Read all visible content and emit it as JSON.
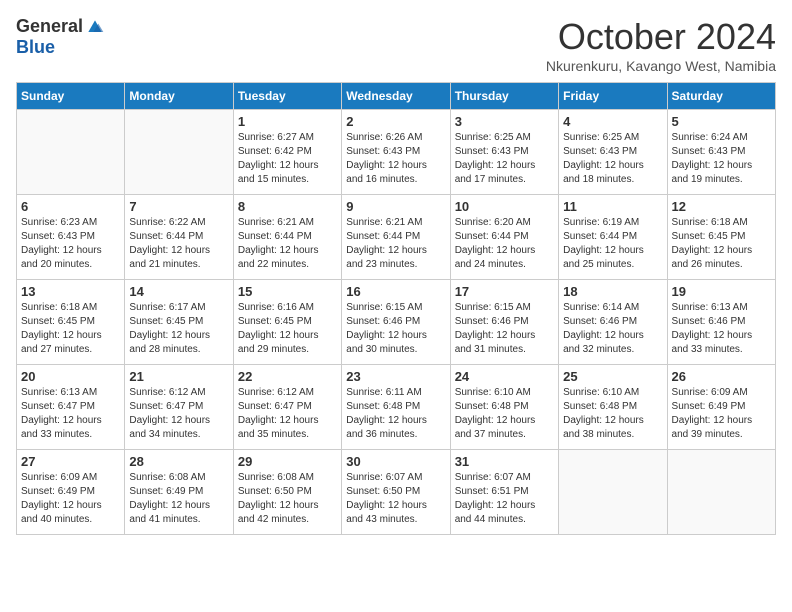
{
  "logo": {
    "general": "General",
    "blue": "Blue"
  },
  "header": {
    "month": "October 2024",
    "location": "Nkurenkuru, Kavango West, Namibia"
  },
  "weekdays": [
    "Sunday",
    "Monday",
    "Tuesday",
    "Wednesday",
    "Thursday",
    "Friday",
    "Saturday"
  ],
  "weeks": [
    [
      {
        "day": null
      },
      {
        "day": null
      },
      {
        "day": "1",
        "sunrise": "Sunrise: 6:27 AM",
        "sunset": "Sunset: 6:42 PM",
        "daylight": "Daylight: 12 hours and 15 minutes."
      },
      {
        "day": "2",
        "sunrise": "Sunrise: 6:26 AM",
        "sunset": "Sunset: 6:43 PM",
        "daylight": "Daylight: 12 hours and 16 minutes."
      },
      {
        "day": "3",
        "sunrise": "Sunrise: 6:25 AM",
        "sunset": "Sunset: 6:43 PM",
        "daylight": "Daylight: 12 hours and 17 minutes."
      },
      {
        "day": "4",
        "sunrise": "Sunrise: 6:25 AM",
        "sunset": "Sunset: 6:43 PM",
        "daylight": "Daylight: 12 hours and 18 minutes."
      },
      {
        "day": "5",
        "sunrise": "Sunrise: 6:24 AM",
        "sunset": "Sunset: 6:43 PM",
        "daylight": "Daylight: 12 hours and 19 minutes."
      }
    ],
    [
      {
        "day": "6",
        "sunrise": "Sunrise: 6:23 AM",
        "sunset": "Sunset: 6:43 PM",
        "daylight": "Daylight: 12 hours and 20 minutes."
      },
      {
        "day": "7",
        "sunrise": "Sunrise: 6:22 AM",
        "sunset": "Sunset: 6:44 PM",
        "daylight": "Daylight: 12 hours and 21 minutes."
      },
      {
        "day": "8",
        "sunrise": "Sunrise: 6:21 AM",
        "sunset": "Sunset: 6:44 PM",
        "daylight": "Daylight: 12 hours and 22 minutes."
      },
      {
        "day": "9",
        "sunrise": "Sunrise: 6:21 AM",
        "sunset": "Sunset: 6:44 PM",
        "daylight": "Daylight: 12 hours and 23 minutes."
      },
      {
        "day": "10",
        "sunrise": "Sunrise: 6:20 AM",
        "sunset": "Sunset: 6:44 PM",
        "daylight": "Daylight: 12 hours and 24 minutes."
      },
      {
        "day": "11",
        "sunrise": "Sunrise: 6:19 AM",
        "sunset": "Sunset: 6:44 PM",
        "daylight": "Daylight: 12 hours and 25 minutes."
      },
      {
        "day": "12",
        "sunrise": "Sunrise: 6:18 AM",
        "sunset": "Sunset: 6:45 PM",
        "daylight": "Daylight: 12 hours and 26 minutes."
      }
    ],
    [
      {
        "day": "13",
        "sunrise": "Sunrise: 6:18 AM",
        "sunset": "Sunset: 6:45 PM",
        "daylight": "Daylight: 12 hours and 27 minutes."
      },
      {
        "day": "14",
        "sunrise": "Sunrise: 6:17 AM",
        "sunset": "Sunset: 6:45 PM",
        "daylight": "Daylight: 12 hours and 28 minutes."
      },
      {
        "day": "15",
        "sunrise": "Sunrise: 6:16 AM",
        "sunset": "Sunset: 6:45 PM",
        "daylight": "Daylight: 12 hours and 29 minutes."
      },
      {
        "day": "16",
        "sunrise": "Sunrise: 6:15 AM",
        "sunset": "Sunset: 6:46 PM",
        "daylight": "Daylight: 12 hours and 30 minutes."
      },
      {
        "day": "17",
        "sunrise": "Sunrise: 6:15 AM",
        "sunset": "Sunset: 6:46 PM",
        "daylight": "Daylight: 12 hours and 31 minutes."
      },
      {
        "day": "18",
        "sunrise": "Sunrise: 6:14 AM",
        "sunset": "Sunset: 6:46 PM",
        "daylight": "Daylight: 12 hours and 32 minutes."
      },
      {
        "day": "19",
        "sunrise": "Sunrise: 6:13 AM",
        "sunset": "Sunset: 6:46 PM",
        "daylight": "Daylight: 12 hours and 33 minutes."
      }
    ],
    [
      {
        "day": "20",
        "sunrise": "Sunrise: 6:13 AM",
        "sunset": "Sunset: 6:47 PM",
        "daylight": "Daylight: 12 hours and 33 minutes."
      },
      {
        "day": "21",
        "sunrise": "Sunrise: 6:12 AM",
        "sunset": "Sunset: 6:47 PM",
        "daylight": "Daylight: 12 hours and 34 minutes."
      },
      {
        "day": "22",
        "sunrise": "Sunrise: 6:12 AM",
        "sunset": "Sunset: 6:47 PM",
        "daylight": "Daylight: 12 hours and 35 minutes."
      },
      {
        "day": "23",
        "sunrise": "Sunrise: 6:11 AM",
        "sunset": "Sunset: 6:48 PM",
        "daylight": "Daylight: 12 hours and 36 minutes."
      },
      {
        "day": "24",
        "sunrise": "Sunrise: 6:10 AM",
        "sunset": "Sunset: 6:48 PM",
        "daylight": "Daylight: 12 hours and 37 minutes."
      },
      {
        "day": "25",
        "sunrise": "Sunrise: 6:10 AM",
        "sunset": "Sunset: 6:48 PM",
        "daylight": "Daylight: 12 hours and 38 minutes."
      },
      {
        "day": "26",
        "sunrise": "Sunrise: 6:09 AM",
        "sunset": "Sunset: 6:49 PM",
        "daylight": "Daylight: 12 hours and 39 minutes."
      }
    ],
    [
      {
        "day": "27",
        "sunrise": "Sunrise: 6:09 AM",
        "sunset": "Sunset: 6:49 PM",
        "daylight": "Daylight: 12 hours and 40 minutes."
      },
      {
        "day": "28",
        "sunrise": "Sunrise: 6:08 AM",
        "sunset": "Sunset: 6:49 PM",
        "daylight": "Daylight: 12 hours and 41 minutes."
      },
      {
        "day": "29",
        "sunrise": "Sunrise: 6:08 AM",
        "sunset": "Sunset: 6:50 PM",
        "daylight": "Daylight: 12 hours and 42 minutes."
      },
      {
        "day": "30",
        "sunrise": "Sunrise: 6:07 AM",
        "sunset": "Sunset: 6:50 PM",
        "daylight": "Daylight: 12 hours and 43 minutes."
      },
      {
        "day": "31",
        "sunrise": "Sunrise: 6:07 AM",
        "sunset": "Sunset: 6:51 PM",
        "daylight": "Daylight: 12 hours and 44 minutes."
      },
      {
        "day": null
      },
      {
        "day": null
      }
    ]
  ]
}
